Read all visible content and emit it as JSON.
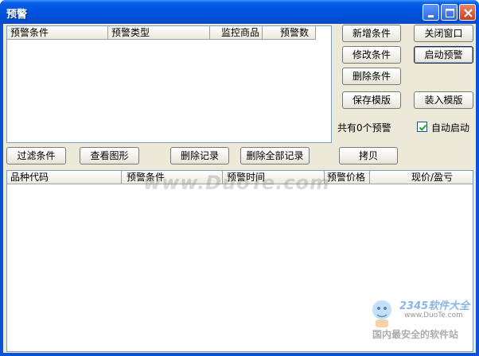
{
  "window": {
    "title": "预警"
  },
  "alert_list": {
    "columns": [
      "预警条件",
      "预警类型",
      "监控商品",
      "预警数"
    ]
  },
  "buttons": {
    "add_condition": "新增条件",
    "close_window": "关闭窗口",
    "edit_condition": "修改条件",
    "start_alert": "启动预警",
    "delete_condition": "删除条件",
    "save_template": "保存模版",
    "load_template": "装入模版",
    "filter_conditions": "过滤条件",
    "view_chart": "查看图形",
    "delete_record": "删除记录",
    "delete_all_records": "删除全部记录",
    "copy": "拷贝"
  },
  "status": {
    "alert_count": "共有0个预警"
  },
  "auto_start": {
    "label": "自动启动",
    "checked": true
  },
  "record_list": {
    "columns": [
      "品种代码",
      "预警条件",
      "预警时间",
      "预警价格",
      "现价/盈亏"
    ]
  },
  "watermark": {
    "text": "www.DuoTe.com",
    "badge_brand": "2345软件大全",
    "badge_url": "www.DuoTe.com",
    "badge_slogan": "国内最安全的软件站"
  }
}
